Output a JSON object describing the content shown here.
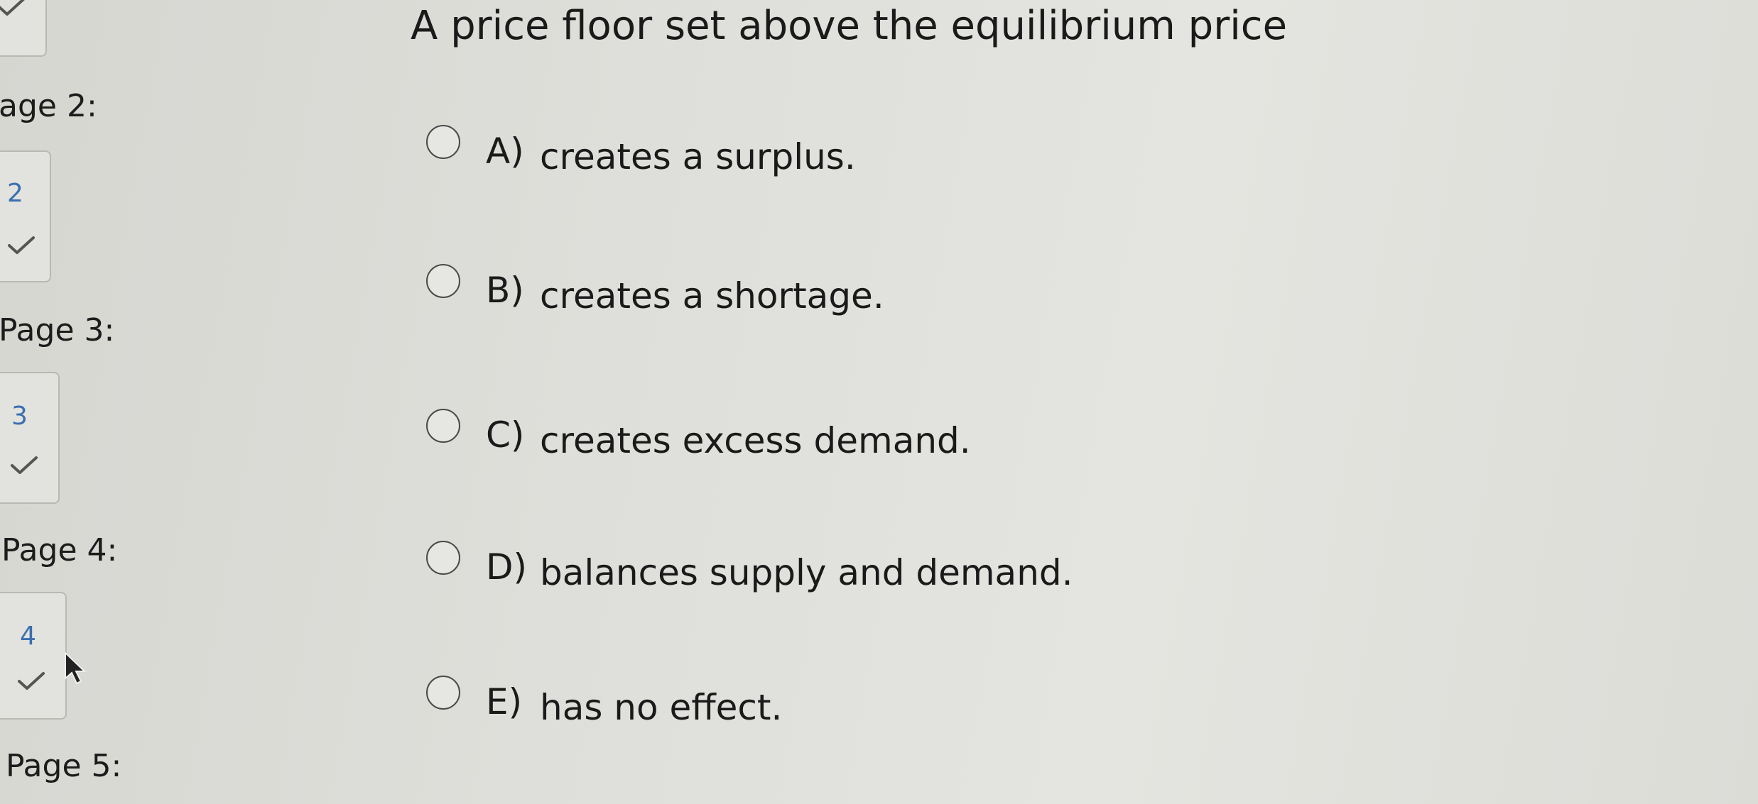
{
  "sidebar": {
    "top_box": {
      "has_check": true
    },
    "pages": [
      {
        "label": "age 2:",
        "number": "2",
        "answered": true
      },
      {
        "label": "Page 3:",
        "number": "3",
        "answered": true
      },
      {
        "label": "Page 4:",
        "number": "4",
        "answered": true
      },
      {
        "label": "Page 5:"
      }
    ]
  },
  "question": {
    "text": "A price floor set above the equilibrium price",
    "options": [
      {
        "letter": "A)",
        "text": "creates a surplus."
      },
      {
        "letter": "B)",
        "text": "creates a shortage."
      },
      {
        "letter": "C)",
        "text": "creates excess demand."
      },
      {
        "letter": "D)",
        "text": "balances supply and demand."
      },
      {
        "letter": "E)",
        "text": "has no effect."
      }
    ]
  },
  "colors": {
    "page_number": "#3a6fb0",
    "check": "#555555"
  }
}
